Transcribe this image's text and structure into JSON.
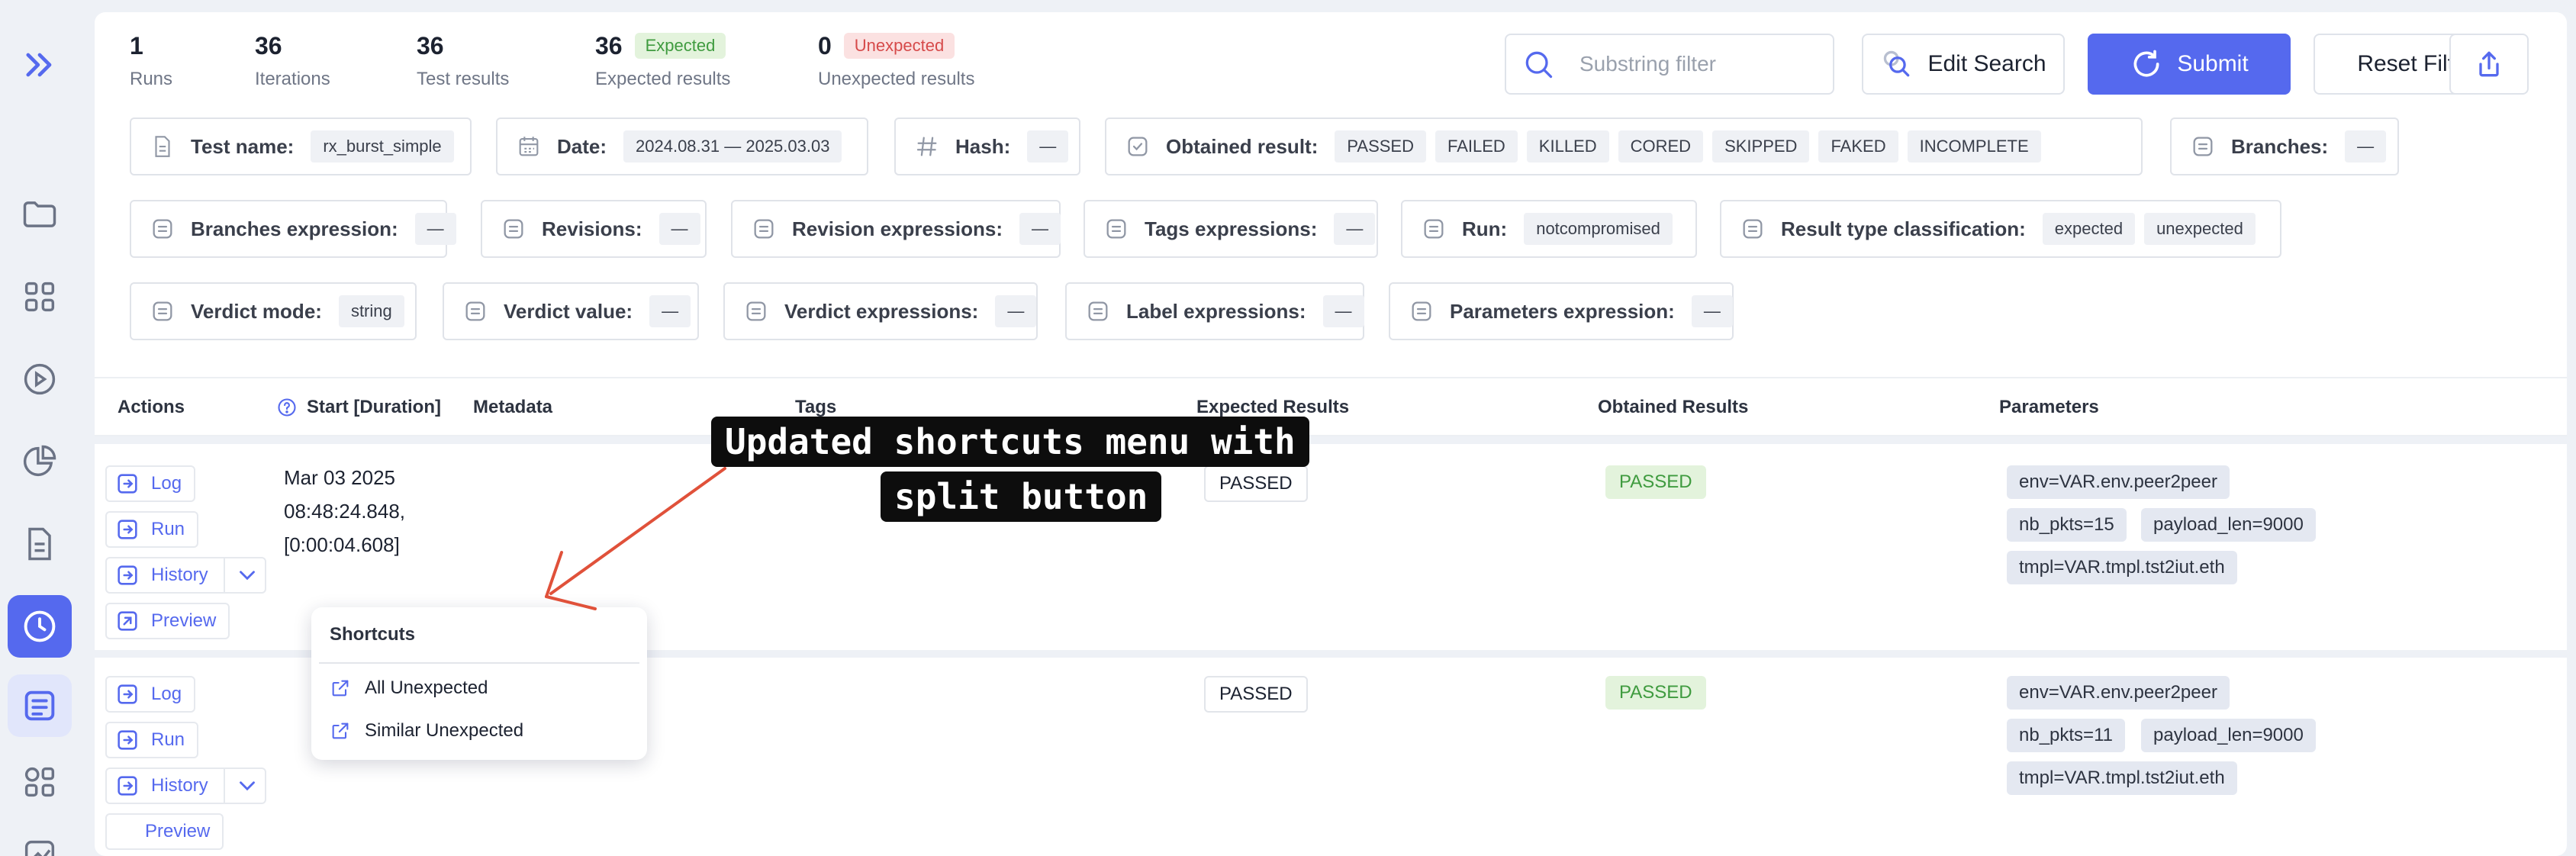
{
  "stats": [
    {
      "value": "1",
      "label": "Runs"
    },
    {
      "value": "36",
      "label": "Iterations"
    },
    {
      "value": "36",
      "label": "Test results"
    },
    {
      "value": "36",
      "label": "Expected results",
      "badge": "Expected"
    },
    {
      "value": "0",
      "label": "Unexpected results",
      "badge": "Unexpected"
    }
  ],
  "toolbar": {
    "search_placeholder": "Substring filter",
    "edit_search": "Edit Search",
    "submit": "Submit",
    "reset": "Reset Filter"
  },
  "filters": {
    "test_name": {
      "label": "Test name:",
      "value": "rx_burst_simple"
    },
    "date": {
      "label": "Date:",
      "value": "2024.08.31 — 2025.03.03"
    },
    "hash": {
      "label": "Hash:",
      "value": "—"
    },
    "obtained": {
      "label": "Obtained result:",
      "values": [
        "PASSED",
        "FAILED",
        "KILLED",
        "CORED",
        "SKIPPED",
        "FAKED",
        "INCOMPLETE"
      ]
    },
    "branches": {
      "label": "Branches:",
      "value": "—"
    },
    "branches_expr": {
      "label": "Branches expression:",
      "value": "—"
    },
    "revisions": {
      "label": "Revisions:",
      "value": "—"
    },
    "revision_expr": {
      "label": "Revision expressions:",
      "value": "—"
    },
    "tags_expr": {
      "label": "Tags expressions:",
      "value": "—"
    },
    "run": {
      "label": "Run:",
      "value": "notcompromised"
    },
    "result_type": {
      "label": "Result type classification:",
      "values": [
        "expected",
        "unexpected"
      ]
    },
    "verdict_mode": {
      "label": "Verdict mode:",
      "value": "string"
    },
    "verdict_value": {
      "label": "Verdict value:",
      "value": "—"
    },
    "verdict_expr": {
      "label": "Verdict expressions:",
      "value": "—"
    },
    "label_expr": {
      "label": "Label expressions:",
      "value": "—"
    },
    "params_expr": {
      "label": "Parameters expression:",
      "value": "—"
    }
  },
  "columns": {
    "actions": "Actions",
    "start": "Start [Duration]",
    "metadata": "Metadata",
    "tags": "Tags",
    "expected": "Expected Results",
    "obtained": "Obtained Results",
    "parameters": "Parameters"
  },
  "actions": {
    "log": "Log",
    "run": "Run",
    "history": "History",
    "preview": "Preview"
  },
  "rows": [
    {
      "date": "Mar 03 2025",
      "time": "08:48:24.848,",
      "duration": "[0:00:04.608]",
      "expected": "PASSED",
      "obtained": "PASSED",
      "params": [
        "env=VAR.env.peer2peer",
        "nb_pkts=15",
        "payload_len=9000",
        "tmpl=VAR.tmpl.tst2iut.eth"
      ]
    },
    {
      "date": "",
      "time": "",
      "duration": "",
      "expected": "PASSED",
      "obtained": "PASSED",
      "params": [
        "env=VAR.env.peer2peer",
        "nb_pkts=11",
        "payload_len=9000",
        "tmpl=VAR.tmpl.tst2iut.eth"
      ]
    }
  ],
  "shortcuts_menu": {
    "title": "Shortcuts",
    "items": [
      "All Unexpected",
      "Similar Unexpected"
    ]
  },
  "annotation": {
    "line1": "Updated shortcuts menu with",
    "line2": "split button"
  },
  "colors": {
    "accent": "#5569ee",
    "pass_bg": "#e3f3dc",
    "pass_fg": "#3f9b3f",
    "fail_bg": "#fbe1e1",
    "fail_fg": "#d64a4a",
    "arrow": "#e0513a"
  }
}
